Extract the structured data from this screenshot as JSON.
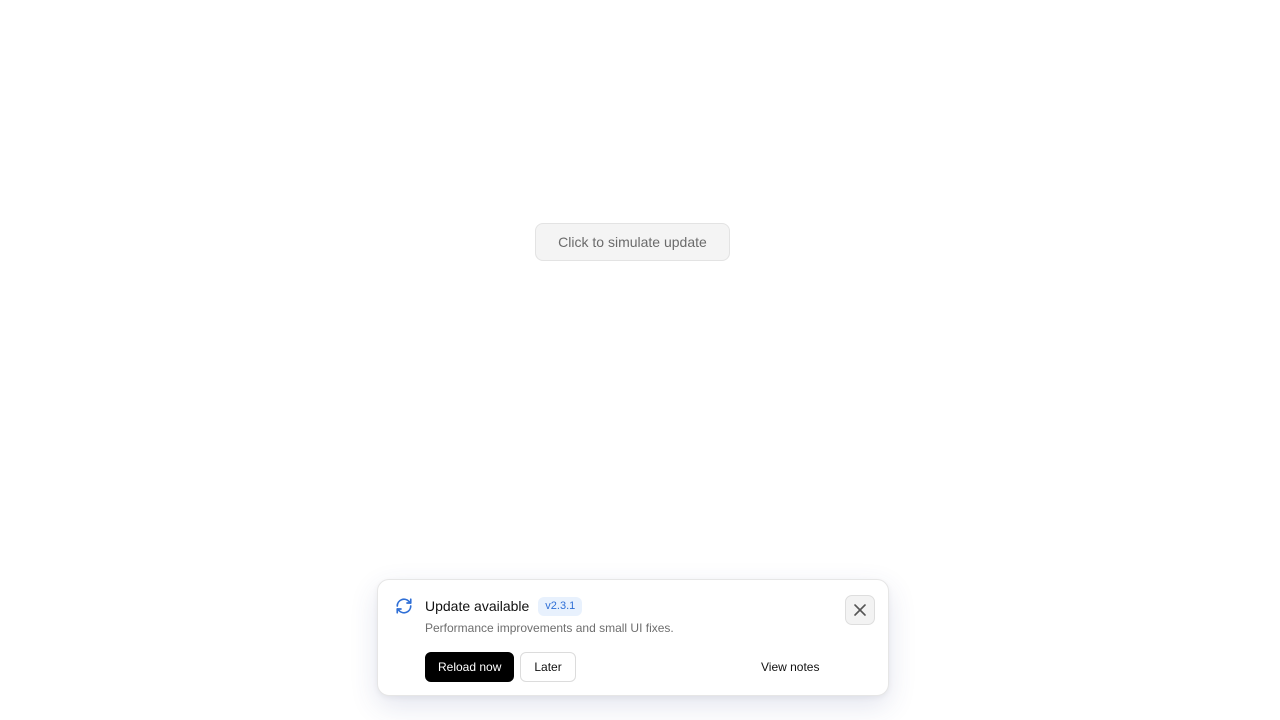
{
  "main": {
    "simulate_label": "Click to simulate update"
  },
  "toast": {
    "icon": "refresh-icon",
    "title": "Update available",
    "version": "v2.3.1",
    "description": "Performance improvements and small UI fixes.",
    "reload_label": "Reload now",
    "later_label": "Later",
    "view_notes_label": "View notes",
    "close_icon": "close-icon"
  },
  "colors": {
    "accent": "#2f6fd6",
    "badge_background": "#e8f1fd",
    "primary_button": "#000000"
  }
}
